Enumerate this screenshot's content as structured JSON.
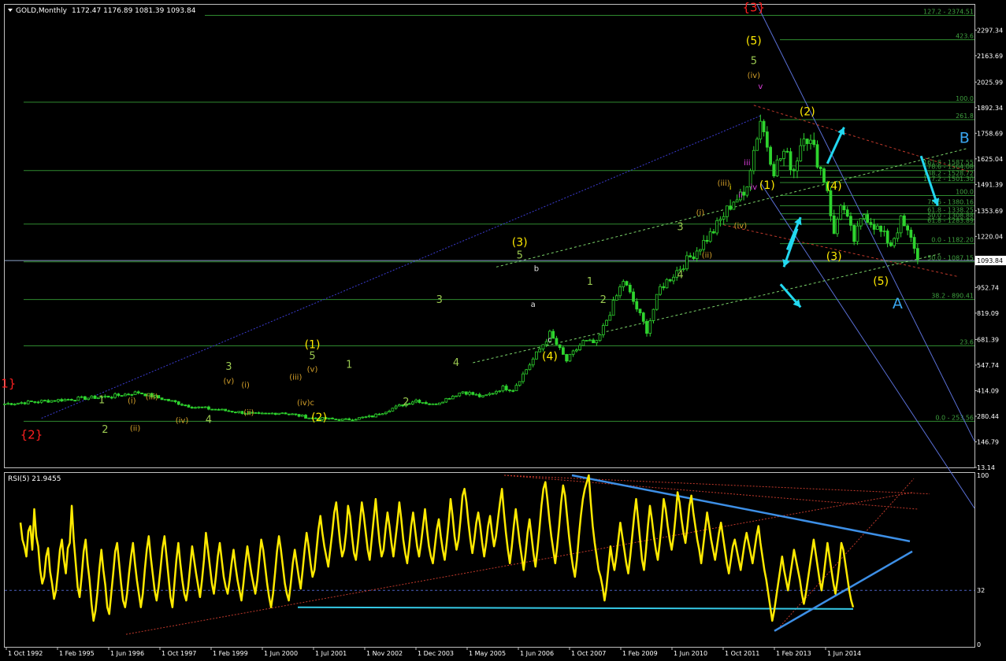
{
  "chart_data": [
    {
      "type": "candlestick",
      "title": "GOLD,Monthly",
      "ohlc": "1172.47 1176.89 1081.39 1093.84",
      "last_price": "1093.84",
      "price_ticks": [
        {
          "value": 2297.34,
          "label": "2297.34"
        },
        {
          "value": 2163.69,
          "label": "2163.69"
        },
        {
          "value": 2025.99,
          "label": "2025.99"
        },
        {
          "value": 1892.34,
          "label": "1892.34"
        },
        {
          "value": 1758.69,
          "label": "1758.69"
        },
        {
          "value": 1625.04,
          "label": "1625.04"
        },
        {
          "value": 1491.39,
          "label": "1491.39"
        },
        {
          "value": 1353.69,
          "label": "1353.69"
        },
        {
          "value": 1220.04,
          "label": "1220.04"
        },
        {
          "value": 952.74,
          "label": "952.74"
        },
        {
          "value": 819.09,
          "label": "819.09"
        },
        {
          "value": 681.39,
          "label": "681.39"
        },
        {
          "value": 547.74,
          "label": "547.74"
        },
        {
          "value": 414.09,
          "label": "414.09"
        },
        {
          "value": 280.44,
          "label": "280.44"
        },
        {
          "value": 146.79,
          "label": "146.79"
        },
        {
          "value": 13.14,
          "label": "13.14"
        }
      ],
      "date_ticks": [
        "1 Oct 1992",
        "1 Feb 1995",
        "1 Jun 1996",
        "1 Oct 1997",
        "1 Feb 1999",
        "1 Jun 2000",
        "1 Jul 2001",
        "1 Nov 2002",
        "1 Dec 2003",
        "1 May 2005",
        "1 Jun 2006",
        "1 Oct 2007",
        "1 Feb 2009",
        "1 Jun 2010",
        "1 Oct 2011",
        "1 Feb 2013",
        "1 Jun 2014"
      ],
      "fib_levels": [
        {
          "label": "127.2 - 2374.51",
          "price": 2374.5
        },
        {
          "label": "423.6",
          "price": 2247
        },
        {
          "label": "100.0",
          "price": 1921
        },
        {
          "label": "261.8",
          "price": 1830
        },
        {
          "label": "161.8 - 1587.55",
          "price": 1588
        },
        {
          "label": "78.6 - 1564.08",
          "price": 1564
        },
        {
          "label": "138.2 - 1528.72",
          "price": 1529
        },
        {
          "label": "127.2 - 1501.30",
          "price": 1501
        },
        {
          "label": "100.0",
          "price": 1433
        },
        {
          "label": "78.6 - 1380.16",
          "price": 1380
        },
        {
          "label": "61.8 - 1338.25",
          "price": 1338
        },
        {
          "label": "50.0 - 1308.88",
          "price": 1309
        },
        {
          "label": "61.8 - 1283.89",
          "price": 1284
        },
        {
          "label": "0.0 - 1182.20",
          "price": 1182
        },
        {
          "label": "50.0 - 1087.15",
          "price": 1087
        },
        {
          "label": "38.2 - 890.41",
          "price": 890
        },
        {
          "label": "23.6",
          "price": 648
        },
        {
          "label": "0.0 - 253.56",
          "price": 254
        }
      ],
      "price_anchors": [
        [
          "1992-10",
          345
        ],
        [
          "1995-06",
          385
        ],
        [
          "1996-02",
          405
        ],
        [
          "1997-06",
          330
        ],
        [
          "1999-02",
          290
        ],
        [
          "1999-09",
          300
        ],
        [
          "2000-06",
          270
        ],
        [
          "2001-04",
          262
        ],
        [
          "2001-12",
          280
        ],
        [
          "2002-06",
          322
        ],
        [
          "2003-01",
          365
        ],
        [
          "2003-06",
          340
        ],
        [
          "2004-03",
          410
        ],
        [
          "2004-09",
          380
        ],
        [
          "2005-03",
          430
        ],
        [
          "2005-06",
          420
        ],
        [
          "2006-05",
          710
        ],
        [
          "2006-10",
          570
        ],
        [
          "2007-03",
          670
        ],
        [
          "2007-07",
          660
        ],
        [
          "2008-03",
          990
        ],
        [
          "2008-06",
          880
        ],
        [
          "2008-10",
          730
        ],
        [
          "2009-02",
          950
        ],
        [
          "2009-12",
          1130
        ],
        [
          "2010-06",
          1250
        ],
        [
          "2010-12",
          1410
        ],
        [
          "2011-03",
          1430
        ],
        [
          "2011-08",
          1830
        ],
        [
          "2011-12",
          1570
        ],
        [
          "2012-03",
          1660
        ],
        [
          "2012-06",
          1570
        ],
        [
          "2012-09",
          1770
        ],
        [
          "2012-12",
          1670
        ],
        [
          "2013-04",
          1470
        ],
        [
          "2013-06",
          1220
        ],
        [
          "2013-08",
          1400
        ],
        [
          "2013-12",
          1200
        ],
        [
          "2014-03",
          1340
        ],
        [
          "2014-06",
          1280
        ],
        [
          "2014-09",
          1220
        ],
        [
          "2014-11",
          1180
        ],
        [
          "2015-02",
          1300
        ],
        [
          "2015-06",
          1170
        ],
        [
          "2015-07",
          1094
        ]
      ],
      "wave_labels": [
        {
          "text": "{3}",
          "date": "2011-06",
          "price": 2395,
          "color": "#ff2020"
        },
        {
          "text": "(5)",
          "date": "2011-06",
          "price": 2222,
          "color": "#ffea00"
        },
        {
          "text": "5",
          "date": "2011-06",
          "price": 2119,
          "color": "#9ac850"
        },
        {
          "text": "(iv)",
          "date": "2011-06",
          "price": 2047,
          "color": "#d4a02a"
        },
        {
          "text": "v",
          "date": "2011-08",
          "price": 1990,
          "color": "#e040e0"
        },
        {
          "text": "(2)",
          "date": "2012-10",
          "price": 1852,
          "color": "#ffea00"
        },
        {
          "text": "iii",
          "date": "2011-04",
          "price": 1592,
          "color": "#e040e0"
        },
        {
          "text": "(1)",
          "date": "2011-10",
          "price": 1469,
          "color": "#ffea00"
        },
        {
          "text": "iv",
          "date": "2011-06",
          "price": 1464,
          "color": "#e040e0"
        },
        {
          "text": "(iii)",
          "date": "2010-09",
          "price": 1485,
          "color": "#d4a02a"
        },
        {
          "text": "i",
          "date": "2010-11",
          "price": 1464,
          "color": "#ffea00"
        },
        {
          "text": "ii",
          "date": "2011-02",
          "price": 1423,
          "color": "#e040e0"
        },
        {
          "text": "(4)",
          "date": "2013-06",
          "price": 1464,
          "color": "#ffea00"
        },
        {
          "text": "(i)",
          "date": "2010-02",
          "price": 1330,
          "color": "#d4a02a"
        },
        {
          "text": "(iv)",
          "date": "2011-02",
          "price": 1263,
          "color": "#d4a02a"
        },
        {
          "text": "3",
          "date": "2009-08",
          "price": 1253,
          "color": "#9ac850"
        },
        {
          "text": "(ii)",
          "date": "2010-04",
          "price": 1109,
          "color": "#d4a02a"
        },
        {
          "text": "(3)",
          "date": "2013-06",
          "price": 1096,
          "color": "#ffea00"
        },
        {
          "text": "4",
          "date": "2009-08",
          "price": 1001,
          "color": "#9ac850"
        },
        {
          "text": "(5)",
          "date": "2014-08",
          "price": 966,
          "color": "#ffea00"
        },
        {
          "text": "(3)",
          "date": "2005-08",
          "price": 1171,
          "color": "#ffea00"
        },
        {
          "text": "5",
          "date": "2005-08",
          "price": 1104,
          "color": "#9ac850"
        },
        {
          "text": "b",
          "date": "2006-01",
          "price": 1038,
          "color": "#e0e0e0"
        },
        {
          "text": "1",
          "date": "2007-05",
          "price": 966,
          "color": "#9ac850"
        },
        {
          "text": "a",
          "date": "2005-12",
          "price": 852,
          "color": "#e0e0e0"
        },
        {
          "text": "2",
          "date": "2007-09",
          "price": 873,
          "color": "#9ac850"
        },
        {
          "text": "3",
          "date": "2003-08",
          "price": 873,
          "color": "#9ac850"
        },
        {
          "text": "c",
          "date": "2006-05",
          "price": 667,
          "color": "#e0e0e0"
        },
        {
          "text": "(4)",
          "date": "2006-05",
          "price": 574,
          "color": "#ffea00"
        },
        {
          "text": "4",
          "date": "2004-01",
          "price": 543,
          "color": "#9ac850"
        },
        {
          "text": "(1)",
          "date": "2000-06",
          "price": 635,
          "color": "#ffea00"
        },
        {
          "text": "5",
          "date": "2000-06",
          "price": 579,
          "color": "#9ac850"
        },
        {
          "text": "(v)",
          "date": "2000-06",
          "price": 512,
          "color": "#d4a02a"
        },
        {
          "text": "1",
          "date": "2001-05",
          "price": 533,
          "color": "#9ac850"
        },
        {
          "text": "(iii)",
          "date": "2000-01",
          "price": 471,
          "color": "#d4a02a"
        },
        {
          "text": "3",
          "date": "1998-05",
          "price": 522,
          "color": "#9ac850"
        },
        {
          "text": "(v)",
          "date": "1998-05",
          "price": 450,
          "color": "#d4a02a"
        },
        {
          "text": "(i)",
          "date": "1998-10",
          "price": 430,
          "color": "#d4a02a"
        },
        {
          "text": "(iv)c",
          "date": "2000-04",
          "price": 337,
          "color": "#d4a02a"
        },
        {
          "text": "(ii)",
          "date": "1998-11",
          "price": 286,
          "color": "#d4a02a"
        },
        {
          "text": "2",
          "date": "2002-10",
          "price": 337,
          "color": "#9ac850"
        },
        {
          "text": "(2)",
          "date": "2000-08",
          "price": 255,
          "color": "#ffea00"
        },
        {
          "text": "(iii)",
          "date": "1996-06",
          "price": 368,
          "color": "#d4a02a"
        },
        {
          "text": "(i)",
          "date": "1995-12",
          "price": 348,
          "color": "#d4a02a"
        },
        {
          "text": "1",
          "date": "1995-03",
          "price": 348,
          "color": "#9ac850"
        },
        {
          "text": "(iv)",
          "date": "1997-03",
          "price": 245,
          "color": "#d4a02a"
        },
        {
          "text": "4",
          "date": "1997-11",
          "price": 245,
          "color": "#9ac850"
        },
        {
          "text": "(ii)",
          "date": "1996-01",
          "price": 204,
          "color": "#d4a02a"
        },
        {
          "text": "2",
          "date": "1995-04",
          "price": 194,
          "color": "#9ac850"
        },
        {
          "text": "{1}",
          "date": "1992-10",
          "price": 430,
          "color": "#ff2020"
        },
        {
          "text": "{2}",
          "date": "1993-06",
          "price": 163,
          "color": "#ff2020"
        },
        {
          "text": "B",
          "date": "2016-09",
          "price": 1709,
          "color": "#3aa6f0"
        },
        {
          "text": "A",
          "date": "2015-01",
          "price": 843,
          "color": "#3aa6f0"
        }
      ]
    },
    {
      "type": "line",
      "title": "RSI(5) 21.9455",
      "ylim": [
        0,
        100
      ],
      "y_ticks": [
        "100",
        "32",
        "0"
      ],
      "level": 32,
      "series": [
        {
          "values": [
            72,
            62,
            58,
            52,
            67,
            70,
            56,
            80,
            64,
            58,
            44,
            36,
            40,
            52,
            57,
            43,
            36,
            27,
            32,
            43,
            56,
            62,
            50,
            42,
            57,
            60,
            82,
            62,
            48,
            34,
            28,
            40,
            55,
            62,
            48,
            38,
            24,
            14,
            20,
            31,
            45,
            56,
            44,
            35,
            22,
            18,
            30,
            42,
            55,
            60,
            48,
            36,
            26,
            22,
            30,
            42,
            52,
            60,
            48,
            38,
            30,
            22,
            30,
            44,
            56,
            64,
            52,
            42,
            32,
            26,
            34,
            45,
            57,
            64,
            52,
            40,
            28,
            22,
            36,
            50,
            60,
            48,
            38,
            30,
            26,
            34,
            46,
            58,
            50,
            42,
            35,
            28,
            38,
            50,
            66,
            56,
            46,
            36,
            30,
            40,
            52,
            60,
            50,
            40,
            34,
            30,
            38,
            48,
            56,
            46,
            38,
            32,
            26,
            36,
            48,
            58,
            50,
            42,
            36,
            30,
            38,
            50,
            62,
            56,
            46,
            36,
            28,
            22,
            30,
            42,
            55,
            64,
            56,
            46,
            36,
            30,
            26,
            36,
            48,
            56,
            48,
            40,
            33,
            44,
            56,
            66,
            58,
            48,
            40,
            44,
            56,
            68,
            76,
            66,
            58,
            52,
            46,
            56,
            66,
            78,
            84,
            72,
            60,
            52,
            56,
            66,
            82,
            76,
            64,
            54,
            50,
            60,
            72,
            84,
            76,
            66,
            56,
            50,
            62,
            74,
            86,
            72,
            60,
            52,
            56,
            68,
            78,
            70,
            60,
            52,
            62,
            72,
            84,
            74,
            62,
            54,
            48,
            58,
            70,
            78,
            68,
            58,
            52,
            60,
            70,
            80,
            68,
            58,
            52,
            48,
            58,
            68,
            74,
            64,
            56,
            50,
            60,
            72,
            86,
            76,
            64,
            56,
            62,
            74,
            88,
            92,
            84,
            72,
            62,
            54,
            62,
            72,
            78,
            70,
            60,
            52,
            60,
            70,
            76,
            66,
            58,
            64,
            74,
            84,
            92,
            78,
            66,
            56,
            48,
            58,
            70,
            80,
            70,
            60,
            52,
            44,
            54,
            66,
            74,
            64,
            54,
            46,
            56,
            68,
            82,
            92,
            96,
            86,
            74,
            64,
            56,
            48,
            58,
            70,
            84,
            94,
            88,
            76,
            64,
            54,
            46,
            40,
            50,
            64,
            76,
            86,
            92,
            96,
            100,
            84,
            70,
            60,
            52,
            44,
            40,
            34,
            26,
            34,
            46,
            58,
            50,
            44,
            52,
            62,
            72,
            64,
            56,
            48,
            42,
            52,
            64,
            76,
            86,
            74,
            62,
            50,
            44,
            56,
            70,
            82,
            74,
            64,
            56,
            50,
            60,
            72,
            86,
            80,
            70,
            62,
            56,
            64,
            76,
            90,
            84,
            74,
            66,
            60,
            70,
            82,
            88,
            78,
            70,
            62,
            56,
            48,
            58,
            68,
            78,
            70,
            62,
            56,
            50,
            58,
            66,
            72,
            64,
            56,
            48,
            42,
            50,
            58,
            62,
            56,
            50,
            44,
            52,
            60,
            66,
            60,
            54,
            48,
            56,
            64,
            70,
            60,
            52,
            44,
            38,
            30,
            22,
            14,
            20,
            28,
            36,
            44,
            52,
            44,
            38,
            32,
            40,
            48,
            56,
            50,
            44,
            38,
            30,
            24,
            30,
            38,
            46,
            54,
            62,
            54,
            46,
            38,
            32,
            40,
            50,
            60,
            52,
            44,
            36,
            30,
            38,
            48,
            60,
            56,
            48,
            40,
            32,
            26,
            22
          ]
        }
      ]
    }
  ]
}
